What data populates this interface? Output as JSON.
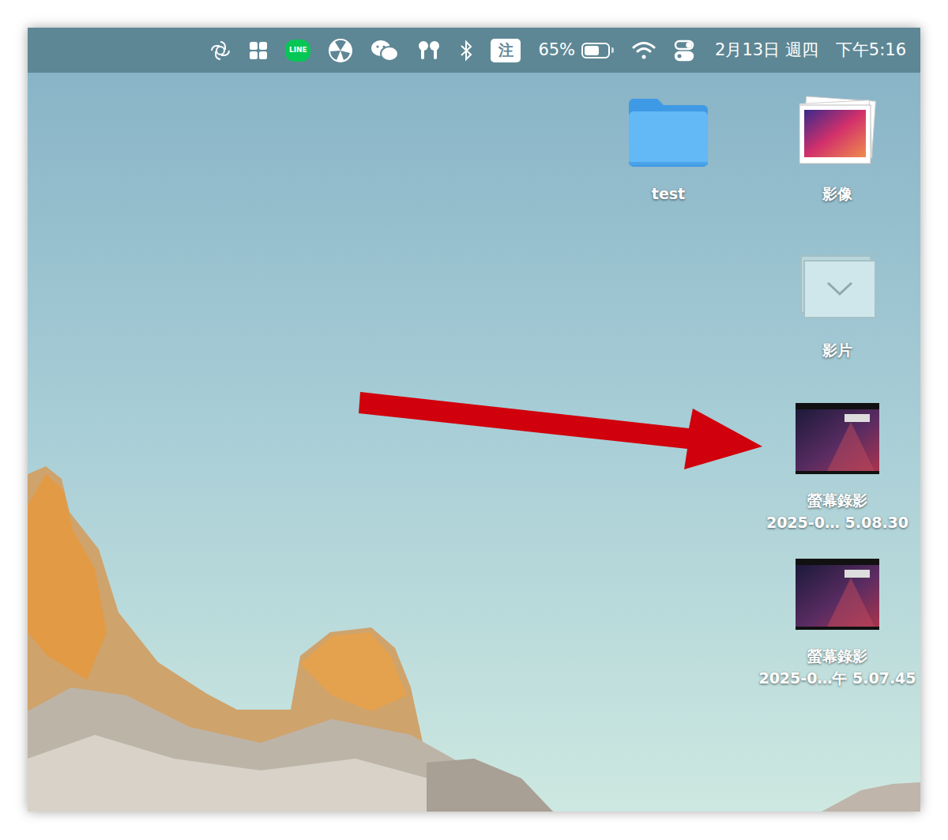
{
  "menu_bar": {
    "status_items": [
      {
        "kind": "chatgpt"
      },
      {
        "kind": "widgets"
      },
      {
        "kind": "line",
        "label": "LINE"
      },
      {
        "kind": "app"
      },
      {
        "kind": "wechat"
      },
      {
        "kind": "airpods"
      },
      {
        "kind": "bluetooth"
      },
      {
        "kind": "input",
        "label": "注"
      },
      {
        "kind": "battery",
        "reading": "65%",
        "level": 0.65
      },
      {
        "kind": "wifi"
      },
      {
        "kind": "control-center"
      }
    ],
    "date": "2月13日 週四",
    "time": "下午5:16"
  },
  "desktop_icons": [
    {
      "kind": "folder",
      "lines": [
        "test"
      ],
      "selected": false
    },
    {
      "kind": "photo-stack",
      "lines": [
        "影像"
      ],
      "selected": false
    },
    {
      "kind": "movie-stack",
      "lines": [
        "影片"
      ],
      "selected": false
    },
    {
      "kind": "recording",
      "lines": [
        "螢幕錄影",
        "2025-0… 5.08.30"
      ],
      "selected": false
    },
    {
      "kind": "recording",
      "lines": [
        "螢幕錄影",
        "2025-0…午 5.07.45"
      ],
      "selected": false
    }
  ]
}
